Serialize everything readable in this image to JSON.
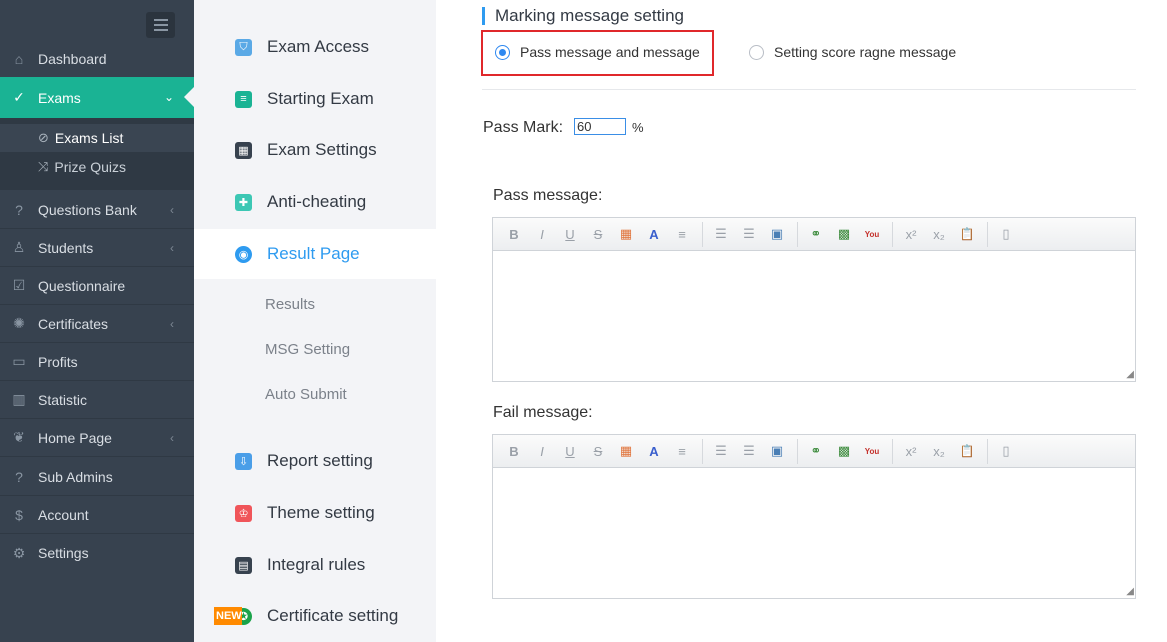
{
  "sidebar": {
    "items": [
      {
        "label": "Dashboard",
        "icon": "home-icon",
        "glyph": "⌂"
      },
      {
        "label": "Exams",
        "icon": "check-circle-icon",
        "glyph": "✓"
      },
      {
        "label": "Questions Bank",
        "icon": "question-circle-icon",
        "glyph": "?"
      },
      {
        "label": "Students",
        "icon": "users-icon",
        "glyph": "♙"
      },
      {
        "label": "Questionnaire",
        "icon": "checkbox-icon",
        "glyph": "☑"
      },
      {
        "label": "Certificates",
        "icon": "badge-icon",
        "glyph": "✺"
      },
      {
        "label": "Profits",
        "icon": "card-icon",
        "glyph": "▭"
      },
      {
        "label": "Statistic",
        "icon": "bar-chart-icon",
        "glyph": "▥"
      },
      {
        "label": "Home Page",
        "icon": "leaf-icon",
        "glyph": "❦"
      },
      {
        "label": "Sub Admins",
        "icon": "question-circle-icon",
        "glyph": "?"
      },
      {
        "label": "Account",
        "icon": "dollar-icon",
        "glyph": "$"
      },
      {
        "label": "Settings",
        "icon": "gear-icon",
        "glyph": "⚙"
      }
    ],
    "sub_items": [
      {
        "label": "Exams List",
        "icon": "check-circle-icon",
        "glyph": "⊘"
      },
      {
        "label": "Prize Quizs",
        "icon": "shuffle-icon",
        "glyph": "⤨"
      }
    ]
  },
  "secondary": {
    "items": [
      {
        "label": "Exam Access",
        "icon": "shield-icon",
        "color": "#5aa9e6",
        "glyph": "⛉"
      },
      {
        "label": "Starting Exam",
        "icon": "document-icon",
        "color": "#1ab394",
        "glyph": "≡"
      },
      {
        "label": "Exam Settings",
        "icon": "grid-icon",
        "color": "#37424f",
        "glyph": "▦"
      },
      {
        "label": "Anti-cheating",
        "icon": "shield-check-icon",
        "color": "#3cc7b4",
        "glyph": "✚"
      },
      {
        "label": "Result Page",
        "icon": "eye-icon",
        "color": "#2e9bf0",
        "glyph": "◉"
      },
      {
        "label": "Report setting",
        "icon": "report-icon",
        "color": "#4a9ee8",
        "glyph": "⇩"
      },
      {
        "label": "Theme setting",
        "icon": "shirt-icon",
        "color": "#f0555a",
        "glyph": "♔"
      },
      {
        "label": "Integral rules",
        "icon": "gift-icon",
        "color": "#37424f",
        "glyph": "▤"
      },
      {
        "label": "Certificate setting",
        "icon": "certificate-icon",
        "color": "#1aa34a",
        "glyph": "✪"
      }
    ],
    "result_sub": [
      "Results",
      "MSG Setting",
      "Auto Submit"
    ],
    "new_badge": "NEW"
  },
  "main": {
    "section_title": "Marking message setting",
    "option_pass": "Pass message and message",
    "option_score": "Setting score ragne message",
    "pass_mark_label": "Pass Mark:",
    "pass_mark_value": "60",
    "pass_mark_unit": "%",
    "pass_message_label": "Pass message:",
    "fail_message_label": "Fail message:"
  },
  "toolbar": [
    {
      "name": "bold-icon",
      "glyph": "B"
    },
    {
      "name": "italic-icon",
      "glyph": "I"
    },
    {
      "name": "underline-icon",
      "glyph": "U"
    },
    {
      "name": "strikethrough-icon",
      "glyph": "S"
    },
    {
      "name": "text-color-icon",
      "glyph": "▦"
    },
    {
      "name": "font-icon",
      "glyph": "A"
    },
    {
      "name": "align-icon",
      "glyph": "≡"
    },
    {
      "sep": true
    },
    {
      "name": "ordered-list-icon",
      "glyph": "☰"
    },
    {
      "name": "unordered-list-icon",
      "glyph": "☰"
    },
    {
      "name": "table-icon",
      "glyph": "▣"
    },
    {
      "sep": true
    },
    {
      "name": "link-icon",
      "glyph": "⚭"
    },
    {
      "name": "image-icon",
      "glyph": "▩"
    },
    {
      "name": "youtube-icon",
      "glyph": "You"
    },
    {
      "sep": true
    },
    {
      "name": "superscript-icon",
      "glyph": "x²"
    },
    {
      "name": "subscript-icon",
      "glyph": "x₂"
    },
    {
      "name": "paste-icon",
      "glyph": "📋"
    },
    {
      "sep": true
    },
    {
      "name": "source-icon",
      "glyph": "▯"
    }
  ]
}
